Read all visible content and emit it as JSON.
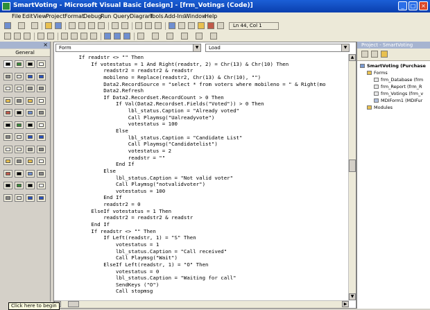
{
  "window": {
    "title": "SmartVoting - Microsoft Visual Basic [design] - [frm_Votings (Code)]"
  },
  "menu": [
    "File",
    "Edit",
    "View",
    "Project",
    "Format",
    "Debug",
    "Run",
    "Query",
    "Diagram",
    "Tools",
    "Add-Ins",
    "Window",
    "Help"
  ],
  "toolbar": {
    "position": "Ln 44, Col 1"
  },
  "toolbox": {
    "title": "General"
  },
  "editor": {
    "object_combo": "Form",
    "proc_combo": "Load",
    "code_lines": [
      "        If readstr <> \"\" Then",
      "            If votestatus = 1 And Right(readstr, 2) = Chr(13) & Chr(10) Then",
      "                readstr2 = readstr2 & readstr",
      "                mobileno = Replace(readstr2, Chr(13) & Chr(10), \"\")",
      "                Data2.RecordSource = \"select * from voters where mobileno = \" & Right(mo",
      "                Data2.Refresh",
      "                If Data2.Recordset.RecordCount > 0 Then",
      "                    If Val(Data2.Recordset.Fields(\"Voted\")) > 0 Then",
      "                        lbl_status.Caption = \"Already voted\"",
      "                        Call Playmsg(\"Ualreadyvote\")",
      "                        votestatus = 100",
      "                    Else",
      "                        lbl_status.Caption = \"Candidate List\"",
      "                        Call Playmsg(\"Candidatelist\")",
      "                        votestatus = 2",
      "                        readstr = \"\"",
      "                    End If",
      "                Else",
      "                    lbl_status.Caption = \"Not valid voter\"",
      "                    Call Playmsg(\"notvalidvoter\")",
      "                    votestatus = 100",
      "                End If",
      "                readstr2 = 0",
      "            ElseIf votestatus = 1 Then",
      "                readstr2 = readstr2 & readstr",
      "            End If",
      "            If readstr <> \"\" Then",
      "                If Left(readstr, 1) = \"S\" Then",
      "                    votestatus = 1",
      "                    lbl_status.Caption = \"Call received\"",
      "                    Call Playmsg(\"Wait\")",
      "                ElseIf Left(readstr, 1) = \"O\" Then",
      "                    votestatus = 0",
      "                    lbl_status.Caption = \"Waiting for call\"",
      "                    SendKeys (\"O\")",
      "                    Call stopmsg"
    ]
  },
  "project": {
    "title": "Project - SmartVoting",
    "items": [
      "SmartVoting (Purchase",
      "Forms",
      "frm_Database (frm",
      "frm_Report (frm_R",
      "frm_Votings (frm_v",
      "MDIForm1 (MDIFur",
      "Modules"
    ]
  },
  "taskbar": {
    "hint": "Click here to begin"
  },
  "colors": {
    "titlebar": "#0a3fae",
    "panel": "#a6b4d0",
    "face": "#d4d0c8"
  }
}
